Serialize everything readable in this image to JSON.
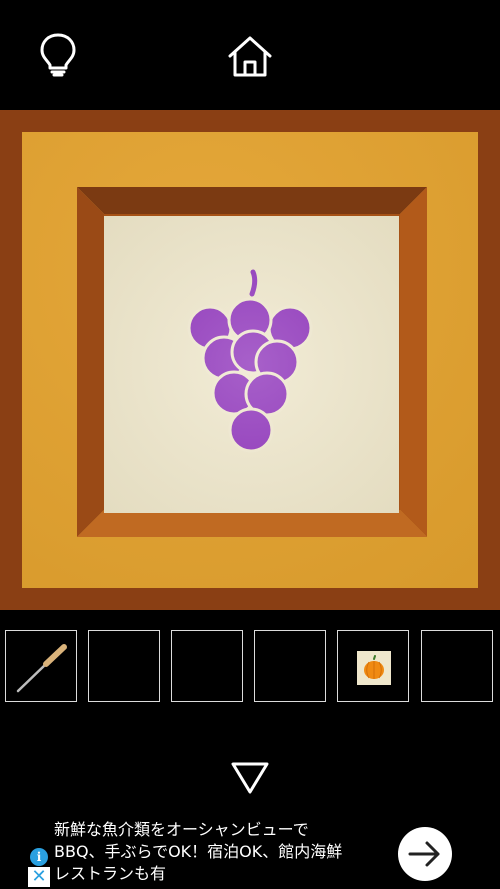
{
  "toolbar": {
    "hint_icon": "lightbulb-icon",
    "home_icon": "home-icon"
  },
  "scene": {
    "object": "grape-panel",
    "icon": "grapes-icon",
    "colors": {
      "wall": "#8a3f14",
      "frame": "#e3a22e",
      "panel": "#ede5c8",
      "grape": "#8a2bb8"
    }
  },
  "inventory": {
    "slots": [
      {
        "item": "screwdriver-icon"
      },
      {
        "item": ""
      },
      {
        "item": ""
      },
      {
        "item": ""
      },
      {
        "item": "pumpkin-card-icon"
      },
      {
        "item": ""
      }
    ]
  },
  "navigation": {
    "back_icon": "down-arrow-icon"
  },
  "ad": {
    "line1": "新鮮な魚介類をオーシャンビューで",
    "line2": "BBQ、手ぶらでOK！宿泊OK、館内海鮮",
    "line3": "レストランも有",
    "info_label": "i",
    "close_label": "✕"
  }
}
